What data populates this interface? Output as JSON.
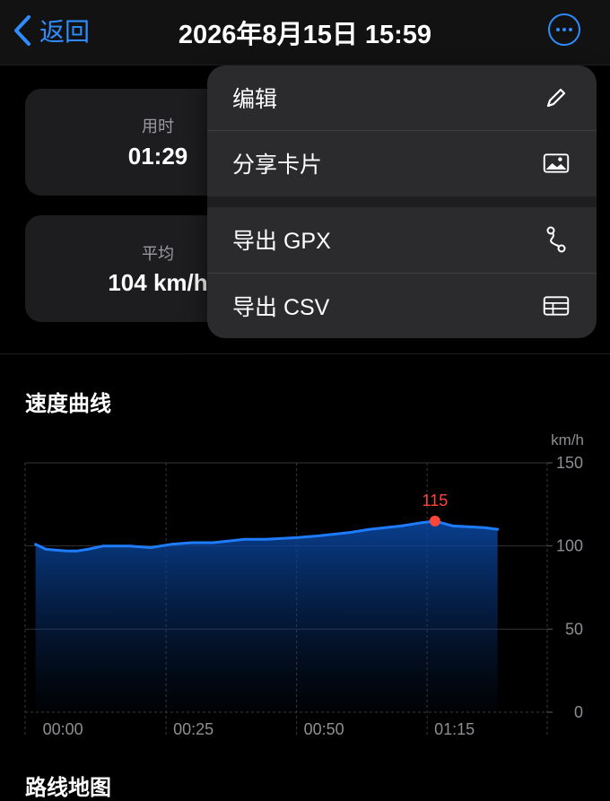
{
  "nav": {
    "back_label": "返回",
    "title": "2026年8月15日 15:59",
    "accent": "#2f8cff",
    "back_icon": "chevron-left-icon",
    "more_icon": "ellipsis-circle-icon"
  },
  "stats": {
    "duration_label": "用时",
    "duration_value": "01:29",
    "avg_label": "平均",
    "avg_value": "104 km/h"
  },
  "menu": {
    "items": [
      {
        "label": "编辑",
        "icon": "pencil-icon"
      },
      {
        "label": "分享卡片",
        "icon": "image-icon"
      },
      {
        "label": "导出 GPX",
        "icon": "route-icon"
      },
      {
        "label": "导出 CSV",
        "icon": "table-icon"
      }
    ]
  },
  "speed_section": {
    "title": "速度曲线"
  },
  "route_section": {
    "title": "路线地图"
  },
  "chart_data": {
    "type": "area",
    "xlabel": "",
    "ylabel": "km/h",
    "ylim": [
      0,
      150
    ],
    "yticks": [
      "150",
      "100",
      "50",
      "0"
    ],
    "xlim_minutes": [
      -2,
      98
    ],
    "xticks": [
      {
        "label": "00:00",
        "min": 0
      },
      {
        "label": "00:25",
        "min": 25
      },
      {
        "label": "00:50",
        "min": 50
      },
      {
        "label": "01:15",
        "min": 75
      }
    ],
    "grid": true,
    "line_color": "#1e7cff",
    "peak": {
      "min": 76.5,
      "value": 115,
      "label": "115",
      "color": "#ff453a"
    },
    "series": [
      {
        "x": [
          0,
          2,
          6,
          8,
          10,
          13,
          18,
          22,
          26,
          30,
          34,
          40,
          44,
          50,
          54,
          60,
          64,
          70,
          74,
          76.5,
          80,
          86,
          88.5
        ],
        "values": [
          101,
          98,
          97,
          97,
          98,
          100,
          100,
          99,
          101,
          102,
          102,
          104,
          104,
          105,
          106,
          108,
          110,
          112,
          114,
          115,
          112,
          111,
          110
        ]
      }
    ]
  }
}
